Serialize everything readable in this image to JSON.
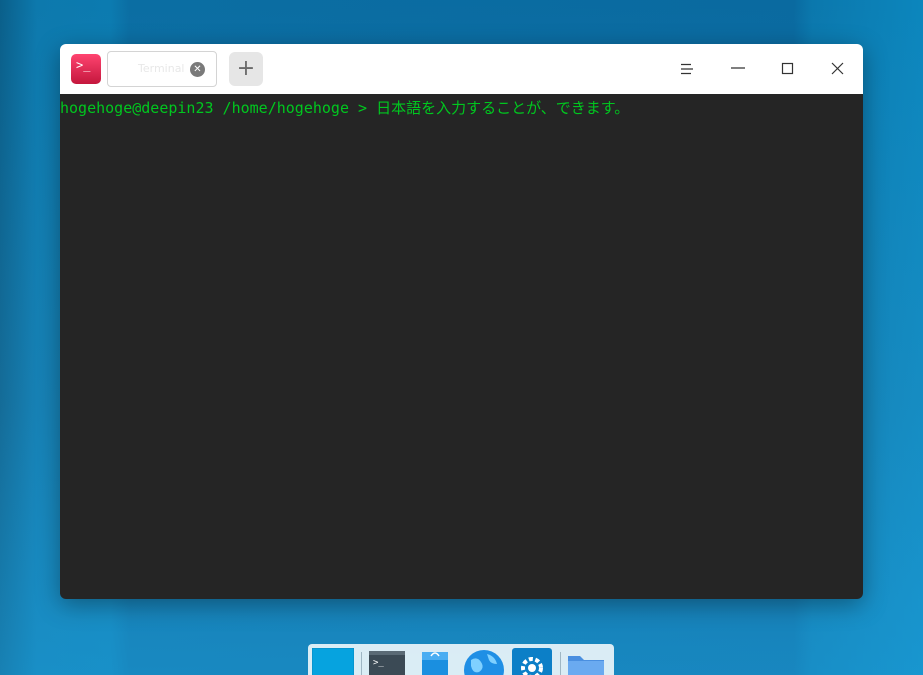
{
  "window": {
    "tab": {
      "label": "Terminal",
      "close_icon": "close-circle-icon"
    },
    "new_tab_label": "+",
    "buttons": {
      "menu_icon": "menu-icon",
      "minimize_icon": "minimize-icon",
      "maximize_icon": "maximize-icon",
      "close_icon": "close-icon"
    }
  },
  "terminal": {
    "line": "hogehoge@deepin23 /home/hogehoge > 日本語を入力することが、できます。",
    "text_color": "#00c71f",
    "background": "#252525"
  },
  "dock": {
    "items": [
      {
        "icon": "show-desktop-icon"
      },
      {
        "icon": "terminal-icon"
      },
      {
        "icon": "app-store-icon"
      },
      {
        "icon": "browser-icon"
      },
      {
        "icon": "settings-icon"
      },
      {
        "icon": "folder-icon"
      }
    ]
  },
  "colors": {
    "accent": "#0a7ab2",
    "app_icon": "#e0214f"
  }
}
